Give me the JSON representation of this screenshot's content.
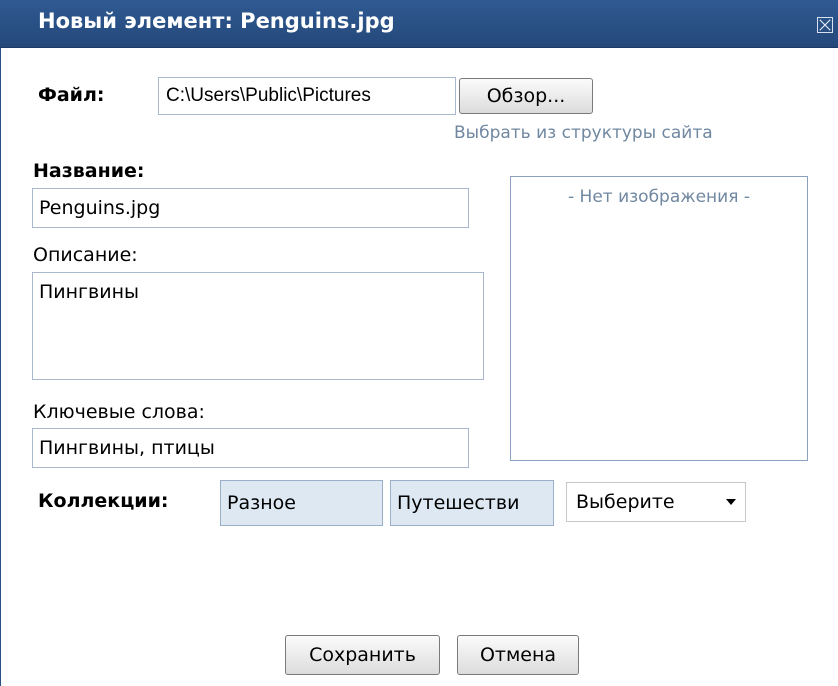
{
  "dialog": {
    "title": "Новый элемент: Penguins.jpg"
  },
  "file": {
    "label": "Файл:",
    "path": "C:\\Users\\Public\\Pictures",
    "browse_button": "Обзор...",
    "site_link": "Выбрать из структуры сайта"
  },
  "name": {
    "label": "Название:",
    "value": "Penguins.jpg"
  },
  "description": {
    "label": "Описание:",
    "value": "Пингвины"
  },
  "keywords": {
    "label": "Ключевые слова:",
    "value": "Пингвины, птицы"
  },
  "preview": {
    "placeholder": "- Нет изображения -"
  },
  "collections": {
    "label": "Коллекции:",
    "items": [
      "Разное",
      "Путешестви"
    ],
    "select_value": "Выберите"
  },
  "actions": {
    "save": "Сохранить",
    "cancel": "Отмена"
  }
}
